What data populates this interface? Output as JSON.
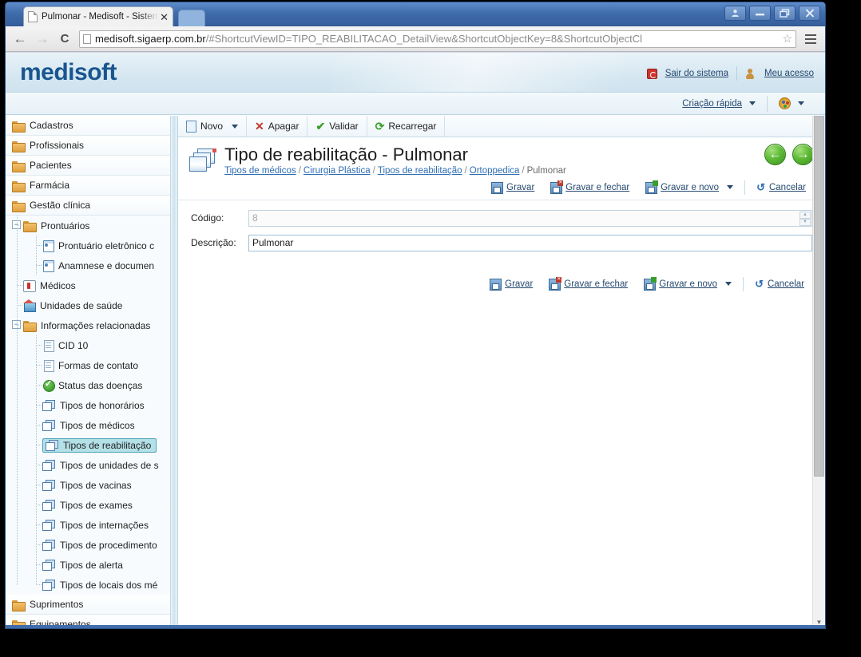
{
  "browser": {
    "tab_title": "Pulmonar - Medisoft - Sistem",
    "tab_close": "✕",
    "url_host": "medisoft.sigaerp.com.br",
    "url_path": "/#ShortcutViewID=TIPO_REABILITACAO_DetailView&ShortcutObjectKey=8&ShortcutObjectCl",
    "back": "←",
    "forward": "→",
    "reload": "C",
    "star": "☆",
    "win_user": "user-icon",
    "win_minimize": "–",
    "win_restore": "❐",
    "win_close": "✕"
  },
  "app_header": {
    "logo": "medisoft",
    "logout": "Sair do sistema",
    "my_access": "Meu acesso",
    "quick_create": "Criação rápida",
    "theme_icon": "palette-icon",
    "accent": "#19558f"
  },
  "sidebar": {
    "roots": [
      {
        "label": "Cadastros"
      },
      {
        "label": "Profissionais"
      },
      {
        "label": "Pacientes"
      },
      {
        "label": "Farmácia"
      },
      {
        "label": "Gestão clínica"
      }
    ],
    "tree": [
      {
        "label": "Prontuários",
        "icon": "folder",
        "level": 1,
        "expander": "−"
      },
      {
        "label": "Prontuário eletrônico c",
        "icon": "card",
        "level": 2
      },
      {
        "label": "Anamnese e documen",
        "icon": "card",
        "level": 2
      },
      {
        "label": "Médicos",
        "icon": "doctor",
        "level": 1
      },
      {
        "label": "Unidades de saúde",
        "icon": "house",
        "level": 1
      },
      {
        "label": "Informações relacionadas",
        "icon": "folder",
        "level": 1,
        "expander": "−"
      },
      {
        "label": "CID 10",
        "icon": "doc",
        "level": 2
      },
      {
        "label": "Formas de contato",
        "icon": "doc",
        "level": 2
      },
      {
        "label": "Status das doenças",
        "icon": "check",
        "level": 2
      },
      {
        "label": "Tipos de honorários",
        "icon": "cube",
        "level": 2
      },
      {
        "label": "Tipos de médicos",
        "icon": "cube",
        "level": 2
      },
      {
        "label": "Tipos de reabilitação",
        "icon": "cube",
        "level": 2,
        "selected": true
      },
      {
        "label": "Tipos de unidades de s",
        "icon": "cube",
        "level": 2
      },
      {
        "label": "Tipos de vacinas",
        "icon": "cube",
        "level": 2
      },
      {
        "label": "Tipos de exames",
        "icon": "cube",
        "level": 2
      },
      {
        "label": "Tipos de internações",
        "icon": "cube",
        "level": 2
      },
      {
        "label": "Tipos de procedimento",
        "icon": "cube",
        "level": 2
      },
      {
        "label": "Tipos de alerta",
        "icon": "cube",
        "level": 2
      },
      {
        "label": "Tipos de locais dos mé",
        "icon": "cube",
        "level": 2
      }
    ],
    "roots_bottom": [
      {
        "label": "Suprimentos"
      },
      {
        "label": "Equipamentos"
      }
    ]
  },
  "toolbar": {
    "new": "Novo",
    "delete": "Apagar",
    "validate": "Validar",
    "reload": "Recarregar"
  },
  "page": {
    "title": "Tipo de reabilitação - Pulmonar",
    "breadcrumb": [
      {
        "label": "Tipos de médicos",
        "link": true
      },
      {
        "label": "Cirurgia Plástica",
        "link": true
      },
      {
        "label": "Tipos de reabilitação",
        "link": true
      },
      {
        "label": "Ortoppedica",
        "link": true
      },
      {
        "label": "Pulmonar",
        "link": false
      }
    ],
    "breadcrumb_sep": "/",
    "nav_prev": "←",
    "nav_next": "→"
  },
  "actions": {
    "save": "Gravar",
    "save_close": "Gravar e fechar",
    "save_new": "Gravar e novo",
    "cancel": "Cancelar"
  },
  "form": {
    "code_label": "Código:",
    "code_value": "8",
    "desc_label": "Descrição:",
    "desc_value": "Pulmonar",
    "spin_up": "▲",
    "spin_down": "▼"
  }
}
